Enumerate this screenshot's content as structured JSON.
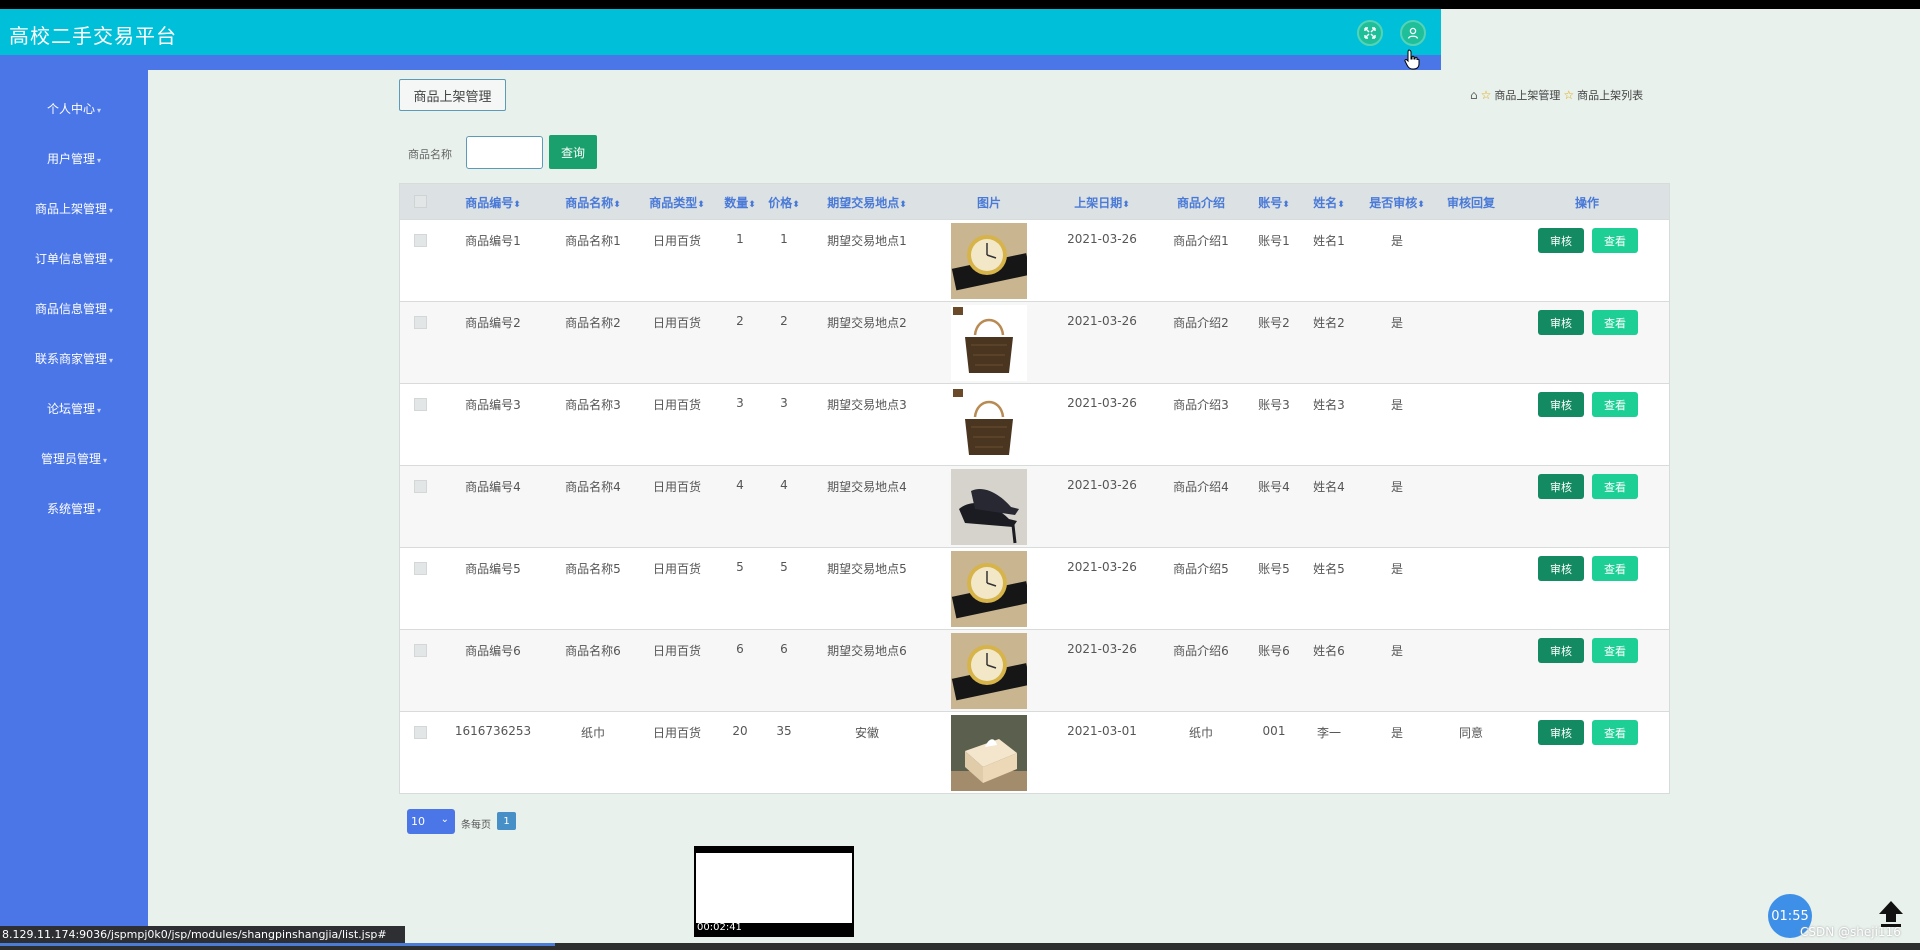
{
  "app": {
    "title": "高校二手交易平台"
  },
  "sidebar": {
    "items": [
      {
        "label": "个人中心"
      },
      {
        "label": "用户管理"
      },
      {
        "label": "商品上架管理"
      },
      {
        "label": "订单信息管理"
      },
      {
        "label": "商品信息管理"
      },
      {
        "label": "联系商家管理"
      },
      {
        "label": "论坛管理"
      },
      {
        "label": "管理员管理"
      },
      {
        "label": "系统管理"
      }
    ]
  },
  "page": {
    "tab_label": "商品上架管理",
    "breadcrumb": [
      "商品上架管理",
      "商品上架列表"
    ]
  },
  "search": {
    "label": "商品名称",
    "value": "",
    "button": "查询"
  },
  "table": {
    "columns": [
      "商品编号",
      "商品名称",
      "商品类型",
      "数量",
      "价格",
      "期望交易地点",
      "图片",
      "上架日期",
      "商品介绍",
      "账号",
      "姓名",
      "是否审核",
      "审核回复",
      "操作"
    ],
    "rows": [
      {
        "code": "商品编号1",
        "name": "商品名称1",
        "type": "日用百货",
        "qty": "1",
        "price": "1",
        "place": "期望交易地点1",
        "image": "watch",
        "date": "2021-03-26",
        "intro": "商品介绍1",
        "account": "账号1",
        "person": "姓名1",
        "audited": "是",
        "reply": ""
      },
      {
        "code": "商品编号2",
        "name": "商品名称2",
        "type": "日用百货",
        "qty": "2",
        "price": "2",
        "place": "期望交易地点2",
        "image": "handbag",
        "date": "2021-03-26",
        "intro": "商品介绍2",
        "account": "账号2",
        "person": "姓名2",
        "audited": "是",
        "reply": ""
      },
      {
        "code": "商品编号3",
        "name": "商品名称3",
        "type": "日用百货",
        "qty": "3",
        "price": "3",
        "place": "期望交易地点3",
        "image": "handbag",
        "date": "2021-03-26",
        "intro": "商品介绍3",
        "account": "账号3",
        "person": "姓名3",
        "audited": "是",
        "reply": ""
      },
      {
        "code": "商品编号4",
        "name": "商品名称4",
        "type": "日用百货",
        "qty": "4",
        "price": "4",
        "place": "期望交易地点4",
        "image": "heels",
        "date": "2021-03-26",
        "intro": "商品介绍4",
        "account": "账号4",
        "person": "姓名4",
        "audited": "是",
        "reply": ""
      },
      {
        "code": "商品编号5",
        "name": "商品名称5",
        "type": "日用百货",
        "qty": "5",
        "price": "5",
        "place": "期望交易地点5",
        "image": "watch",
        "date": "2021-03-26",
        "intro": "商品介绍5",
        "account": "账号5",
        "person": "姓名5",
        "audited": "是",
        "reply": ""
      },
      {
        "code": "商品编号6",
        "name": "商品名称6",
        "type": "日用百货",
        "qty": "6",
        "price": "6",
        "place": "期望交易地点6",
        "image": "watch",
        "date": "2021-03-26",
        "intro": "商品介绍6",
        "account": "账号6",
        "person": "姓名6",
        "audited": "是",
        "reply": ""
      },
      {
        "code": "1616736253",
        "name": "纸巾",
        "type": "日用百货",
        "qty": "20",
        "price": "35",
        "place": "安徽",
        "image": "tissue",
        "date": "2021-03-01",
        "intro": "纸巾",
        "account": "001",
        "person": "李一",
        "audited": "是",
        "reply": "同意"
      }
    ],
    "actions": {
      "audit": "审核",
      "view": "查看"
    }
  },
  "pager": {
    "page_size": "10",
    "per_page_label": "条每页",
    "current_page": "1"
  },
  "overlay": {
    "video_time": "00:02:41",
    "status_url": "8.129.11.174:9036/jspmpj0k0/jsp/modules/shangpinshangjia/list.jsp#",
    "timer": "01:55",
    "watermark": "CSDN @sheji116"
  },
  "colors": {
    "header": "#00c0d9",
    "sidebar": "#4b76e7",
    "accent_green": "#1aa06d",
    "view_button": "#1ecf95",
    "background": "#e8f1ec"
  }
}
